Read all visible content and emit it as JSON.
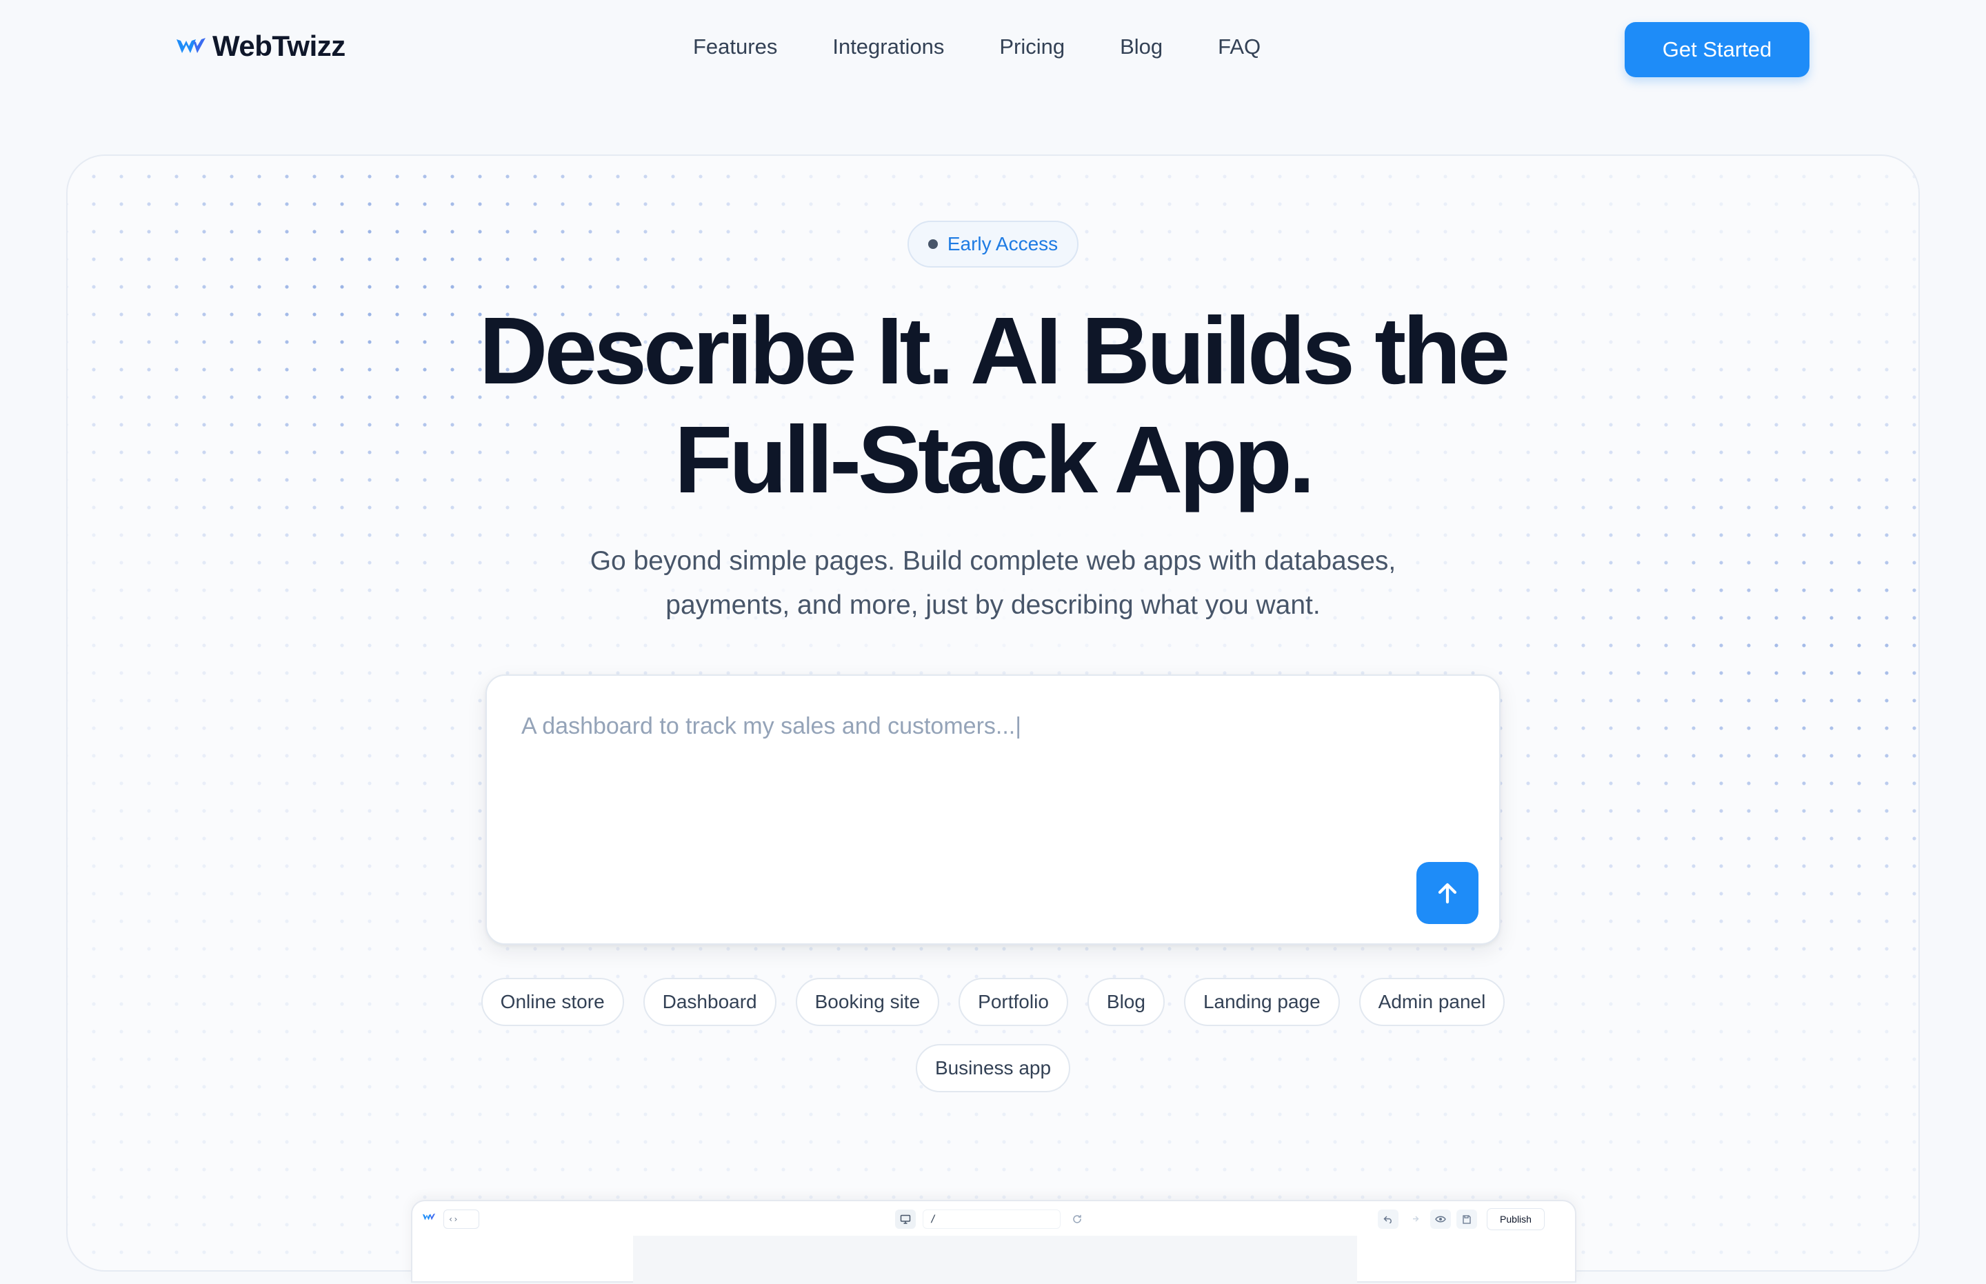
{
  "nav": {
    "logo_text": "WebTwizz",
    "links": [
      "Features",
      "Integrations",
      "Pricing",
      "Blog",
      "FAQ"
    ],
    "cta_label": "Get Started"
  },
  "hero": {
    "badge": "Early Access",
    "headline_line1": "Describe It. AI Builds the",
    "headline_line2": "Full-Stack App.",
    "subtitle_line1": "Go beyond simple pages. Build complete web apps with databases,",
    "subtitle_line2": "payments, and more, just by describing what you want.",
    "prompt_placeholder": "A dashboard to track my sales and customers...|",
    "prompt_value": "",
    "chips": [
      "Online store",
      "Dashboard",
      "Booking site",
      "Portfolio",
      "Blog",
      "Landing page",
      "Admin panel",
      "Business app"
    ]
  },
  "preview": {
    "code_toggle": "‹›",
    "url_path": "/",
    "publish_label": "Publish"
  },
  "colors": {
    "accent": "#1e8cf8",
    "badge_text": "#1e7be3",
    "heading": "#0e1628",
    "body_text": "#475569",
    "dot_pattern": "#9bb4e6"
  },
  "icons": {
    "logo": "w-logo-icon",
    "send": "arrow-up-icon",
    "badge": "status-dot-icon",
    "preview_monitor": "monitor-icon",
    "preview_refresh": "refresh-icon",
    "preview_undo": "undo-icon",
    "preview_redo": "redo-icon",
    "preview_eye": "eye-icon",
    "preview_save": "save-icon"
  }
}
